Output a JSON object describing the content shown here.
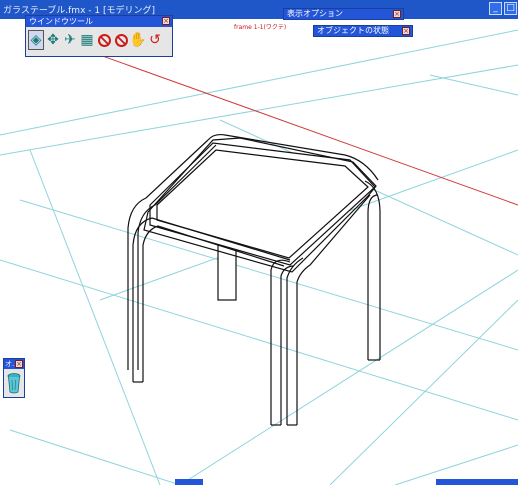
{
  "window": {
    "title": "ガラステーブル.fmx - 1 [モデリング]",
    "minimize_glyph": "_",
    "maximize_glyph": "□"
  },
  "viewport": {
    "frame_label": "frame 1-1(ワクテ)",
    "background": "#ffffff",
    "grid_color": "#8fd3dd",
    "axis_color": "#d23a3a"
  },
  "palettes": {
    "window_tool": {
      "title": "ウインドウツール",
      "close": "×",
      "tools": [
        {
          "name": "rotate-view-icon",
          "glyph": "◈",
          "color": "#1c7a7a",
          "active": true
        },
        {
          "name": "pan-view-icon",
          "glyph": "✥",
          "color": "#1c7a7a",
          "active": false
        },
        {
          "name": "walk-view-icon",
          "glyph": "✈",
          "color": "#1c7a7a",
          "active": false
        },
        {
          "name": "grid-view-icon",
          "glyph": "▦",
          "color": "#1c7a7a",
          "active": false
        },
        {
          "name": "no-select-icon",
          "glyph": "⃠",
          "color": "#cc1a1a",
          "active": false
        },
        {
          "name": "no-move-icon",
          "glyph": "⃠",
          "color": "#cc1a1a",
          "active": false
        },
        {
          "name": "hand-icon",
          "glyph": "✋",
          "color": "#1c7a7a",
          "active": false
        },
        {
          "name": "undo-rotate-icon",
          "glyph": "↺",
          "color": "#cc1a1a",
          "active": false
        }
      ]
    },
    "display_options": {
      "title": "表示オプション",
      "close": "×"
    },
    "object_state": {
      "title": "オブジェクトの状態",
      "close": "×"
    },
    "small_palette": {
      "title": "オ...",
      "close": "×"
    }
  }
}
